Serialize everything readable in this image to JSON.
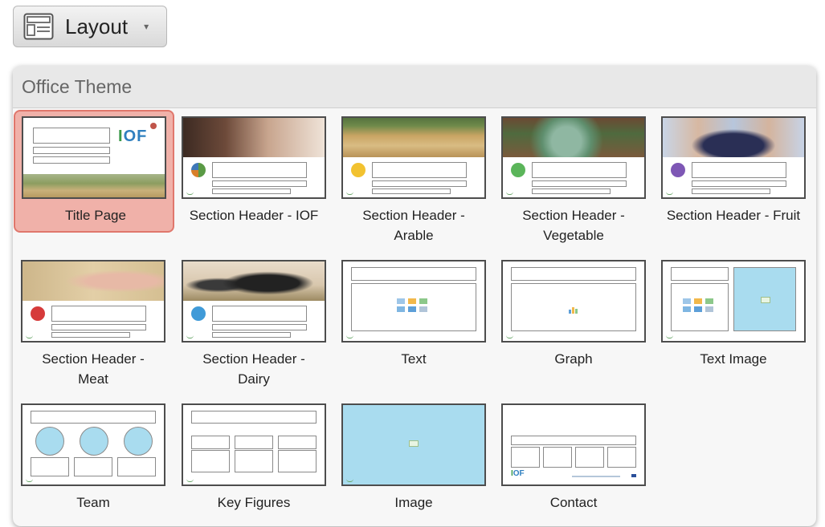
{
  "toolbar": {
    "layout_label": "Layout",
    "icon": "layout-icon",
    "caret": "▾"
  },
  "panel": {
    "title": "Office Theme",
    "layouts": [
      {
        "label": "Title Page",
        "selected": true,
        "logo_text": "IOF"
      },
      {
        "label": "Section Header - IOF",
        "selected": false
      },
      {
        "label": "Section Header -\nArable",
        "selected": false
      },
      {
        "label": "Section Header -\nVegetable",
        "selected": false
      },
      {
        "label": "Section Header - Fruit",
        "selected": false
      },
      {
        "label": "Section Header -\nMeat",
        "selected": false
      },
      {
        "label": "Section Header -\nDairy",
        "selected": false
      },
      {
        "label": "Text",
        "selected": false
      },
      {
        "label": "Graph",
        "selected": false
      },
      {
        "label": "Text  Image",
        "selected": false
      },
      {
        "label": "Team",
        "selected": false
      },
      {
        "label": "Key Figures",
        "selected": false
      },
      {
        "label": "Image",
        "selected": false
      },
      {
        "label": "Contact",
        "selected": false,
        "logo_text": "IOF"
      }
    ]
  },
  "colors": {
    "selected_bg": "#f0b1a9",
    "selected_border": "#e0776c",
    "image_placeholder": "#a9dcef"
  }
}
